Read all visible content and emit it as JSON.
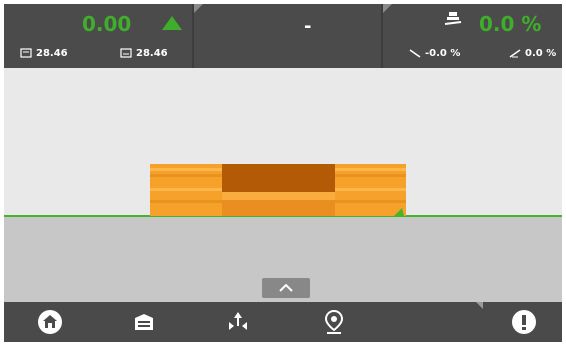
{
  "top": {
    "left_panel": {
      "main_value": "0.00",
      "left_value": "28.46",
      "right_value": "28.46",
      "accent": "#3fae2a"
    },
    "center_panel": {
      "value": "-"
    },
    "right_panel": {
      "main_value": "0.0 %",
      "slope_value": "-0.0 %",
      "cross_slope_value": "0.0 %"
    }
  },
  "colors": {
    "machine_orange": "#f6a12a",
    "machine_dark": "#b25a05",
    "ground": "#c7c7c7",
    "sky": "#e9e9e9",
    "green_line": "#46b42a"
  },
  "icons": {
    "up_triangle": "up-triangle-icon",
    "left_box": "screen-left-icon",
    "right_box": "screen-right-icon",
    "grade": "grade-screed-icon",
    "slope": "slope-icon",
    "cross_slope": "cross-slope-icon",
    "expand": "chevron-up-icon",
    "home": "home-icon",
    "machine": "machine-icon",
    "adjust": "adjust-icon",
    "location": "location-pin-icon",
    "alert": "alert-icon"
  }
}
